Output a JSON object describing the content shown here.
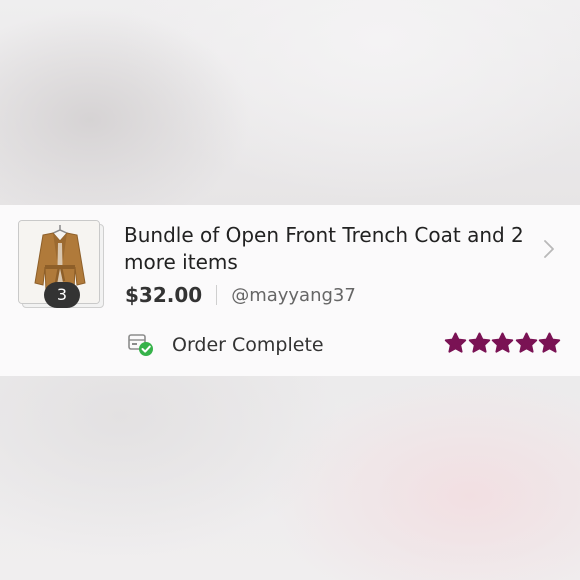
{
  "order": {
    "title": "Bundle of Open Front Trench Coat and 2 more items",
    "item_count": "3",
    "price": "$32.00",
    "seller": "@mayyang37",
    "status": "Order Complete",
    "rating": 5,
    "max_rating": 5
  },
  "colors": {
    "star": "#7a1254",
    "status_check": "#36b24a",
    "badge_bg": "#333333",
    "coat": "#b07a3a"
  },
  "icons": {
    "thumbnail": "trench-coat-photo",
    "chevron": "chevron-right-icon",
    "status": "shipping-box-check-icon",
    "rating": "star-icon"
  }
}
